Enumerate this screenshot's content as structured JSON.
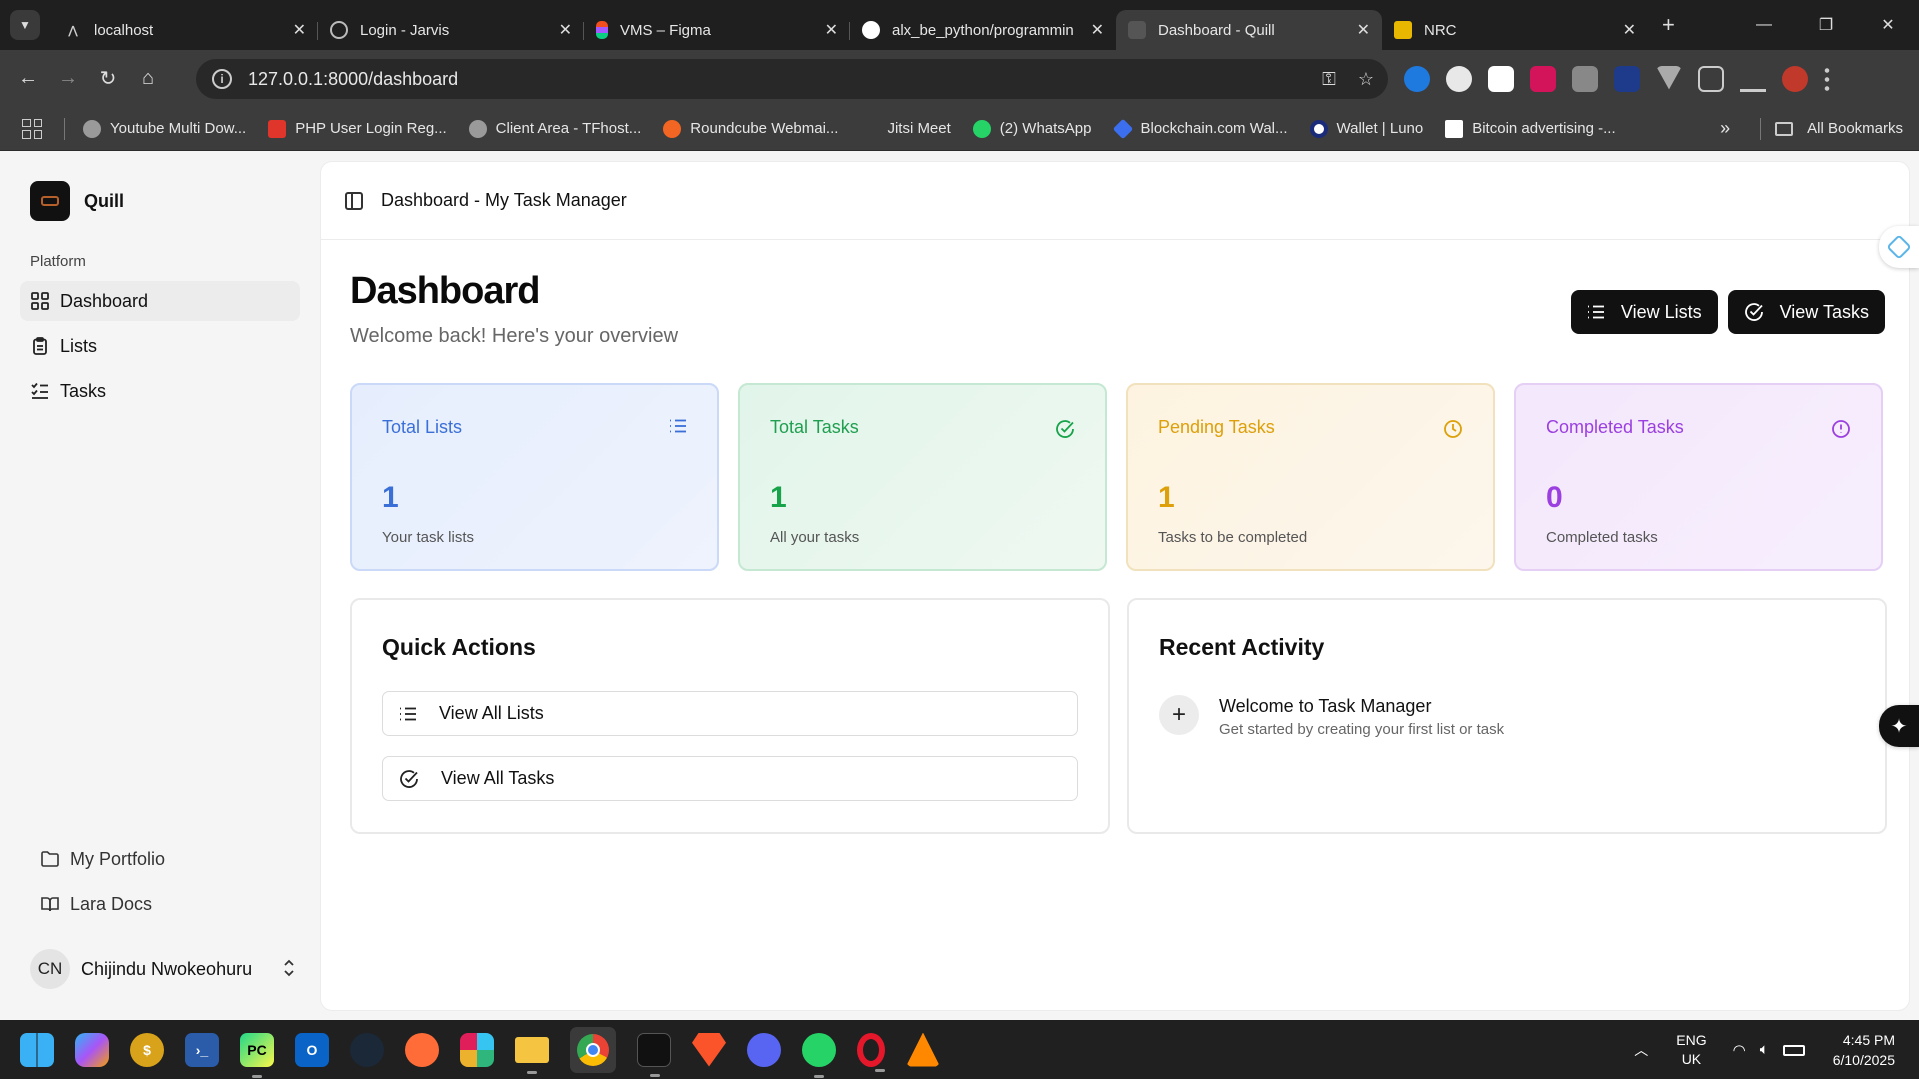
{
  "browser": {
    "tabs": [
      {
        "title": "localhost",
        "favicon": "laravel-icon",
        "active": false
      },
      {
        "title": "Login - Jarvis",
        "favicon": "globe-icon",
        "active": false
      },
      {
        "title": "VMS – Figma",
        "favicon": "figma-icon",
        "active": false
      },
      {
        "title": "alx_be_python/programmin",
        "favicon": "github-icon",
        "active": false
      },
      {
        "title": "Dashboard - Quill",
        "favicon": "quill-icon",
        "active": true
      },
      {
        "title": "NRC",
        "favicon": "nrc-icon",
        "active": false
      }
    ],
    "url": "127.0.0.1:8000/dashboard",
    "bookmarks": [
      {
        "label": "Youtube Multi Dow...",
        "icon": "globe-icon",
        "color": "#9a9a9a"
      },
      {
        "label": "PHP User Login Reg...",
        "icon": "laravel-icon",
        "color": "#e0352b"
      },
      {
        "label": "Client Area - TFhost...",
        "icon": "globe-icon",
        "color": "#9a9a9a"
      },
      {
        "label": "Roundcube Webmai...",
        "icon": "cpanel-icon",
        "color": "#f26522"
      },
      {
        "label": "Jitsi Meet",
        "icon": "jitsi-icon",
        "color": "#3c3c3c"
      },
      {
        "label": "(2) WhatsApp",
        "icon": "whatsapp-icon",
        "color": "#25d366"
      },
      {
        "label": "Blockchain.com Wal...",
        "icon": "blockchain-icon",
        "color": "#3c6ff0"
      },
      {
        "label": "Wallet | Luno",
        "icon": "luno-icon",
        "color": "#1a2b7a"
      },
      {
        "label": "Bitcoin advertising -...",
        "icon": "btc-icon",
        "color": "#ffffff"
      }
    ],
    "all_bookmarks": "All Bookmarks"
  },
  "app": {
    "brand": "Quill",
    "nav_group": "Platform",
    "nav": [
      {
        "label": "Dashboard",
        "icon": "grid-icon",
        "active": true
      },
      {
        "label": "Lists",
        "icon": "clipboard-icon",
        "active": false
      },
      {
        "label": "Tasks",
        "icon": "list-check-icon",
        "active": false
      }
    ],
    "footer_links": [
      {
        "label": "My Portfolio",
        "icon": "folder-icon"
      },
      {
        "label": "Lara Docs",
        "icon": "book-icon"
      }
    ],
    "user": {
      "initials": "CN",
      "name": "Chijindu Nwokeohuru"
    },
    "breadcrumb": "Dashboard - My Task Manager",
    "page_title": "Dashboard",
    "page_subtitle": "Welcome back! Here's your overview",
    "buttons": {
      "view_lists": "View Lists",
      "view_tasks": "View Tasks"
    },
    "stats": [
      {
        "label": "Total Lists",
        "value": "1",
        "desc": "Your task lists",
        "icon": "list-icon",
        "color": "#3b6fd8"
      },
      {
        "label": "Total Tasks",
        "value": "1",
        "desc": "All your tasks",
        "icon": "check-circle-icon",
        "color": "#16a34a"
      },
      {
        "label": "Pending Tasks",
        "value": "1",
        "desc": "Tasks to be completed",
        "icon": "clock-icon",
        "color": "#dda00a"
      },
      {
        "label": "Completed Tasks",
        "value": "0",
        "desc": "Completed tasks",
        "icon": "alert-circle-icon",
        "color": "#9b3fe0"
      }
    ],
    "quick_actions": {
      "title": "Quick Actions",
      "items": [
        {
          "label": "View All Lists",
          "icon": "list-icon"
        },
        {
          "label": "View All Tasks",
          "icon": "check-circle-icon"
        }
      ]
    },
    "recent_activity": {
      "title": "Recent Activity",
      "items": [
        {
          "title": "Welcome to Task Manager",
          "subtitle": "Get started by creating your first list or task",
          "icon": "plus-icon"
        }
      ]
    }
  },
  "taskbar": {
    "language": {
      "line1": "ENG",
      "line2": "UK"
    },
    "time": "4:45 PM",
    "date": "6/10/2025"
  }
}
